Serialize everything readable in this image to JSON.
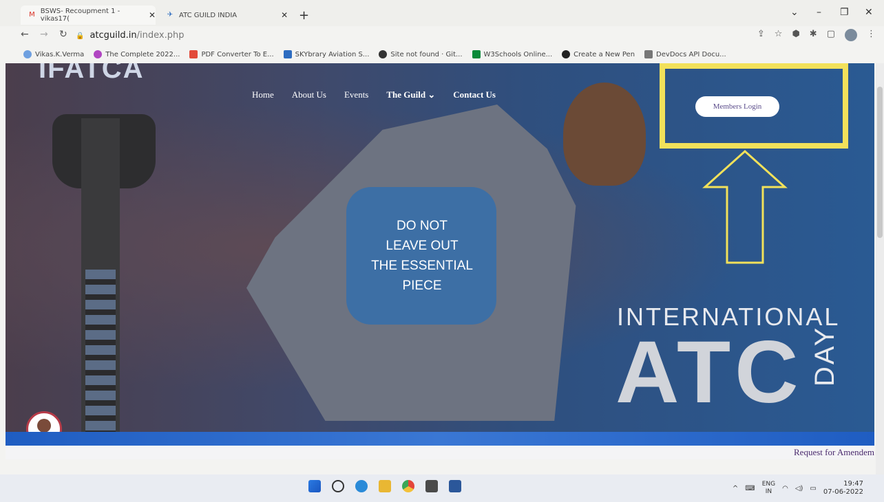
{
  "browser": {
    "tabs": [
      {
        "title": "BSWS- Recoupment 1 - vikas17(",
        "favicon": "gmail-icon",
        "active": true
      },
      {
        "title": "ATC GUILD INDIA",
        "favicon": "site-icon",
        "active": false
      }
    ],
    "new_tab": "+",
    "url_host": "atcguild.in",
    "url_path": "/index.php",
    "bookmarks": [
      {
        "label": "Vikas.K.Verma",
        "color": "#6fa0e0"
      },
      {
        "label": "The Complete 2022...",
        "color": "#b146c2"
      },
      {
        "label": "PDF Converter To E...",
        "color": "#e24b3b"
      },
      {
        "label": "SKYbrary Aviation S...",
        "color": "#2d6cc0"
      },
      {
        "label": "Site not found · Git...",
        "color": "#333333"
      },
      {
        "label": "W3Schools Online...",
        "color": "#0a8a3a"
      },
      {
        "label": "Create a New Pen",
        "color": "#222222"
      },
      {
        "label": "DevDocs API Docu...",
        "color": "#777777"
      }
    ]
  },
  "site": {
    "logo": "IFATCA",
    "nav": [
      "Home",
      "About Us",
      "Events",
      "The Guild ⌄",
      "Contact Us"
    ],
    "members_login": "Members Login",
    "puzzle_lines": [
      "DO NOT",
      "LEAVE OUT",
      "THE ESSENTIAL",
      "PIECE"
    ],
    "banner_international": "INTERNATIONAL",
    "banner_atc": "ATC",
    "banner_day": "DAY",
    "ticker": "Request for Amendem"
  },
  "taskbar": {
    "lang_top": "ENG",
    "lang_bottom": "IN",
    "time": "19:47",
    "date": "07-06-2022"
  },
  "colors": {
    "highlight": "#f2e15a",
    "blue_bar": "#1f5dc2"
  }
}
